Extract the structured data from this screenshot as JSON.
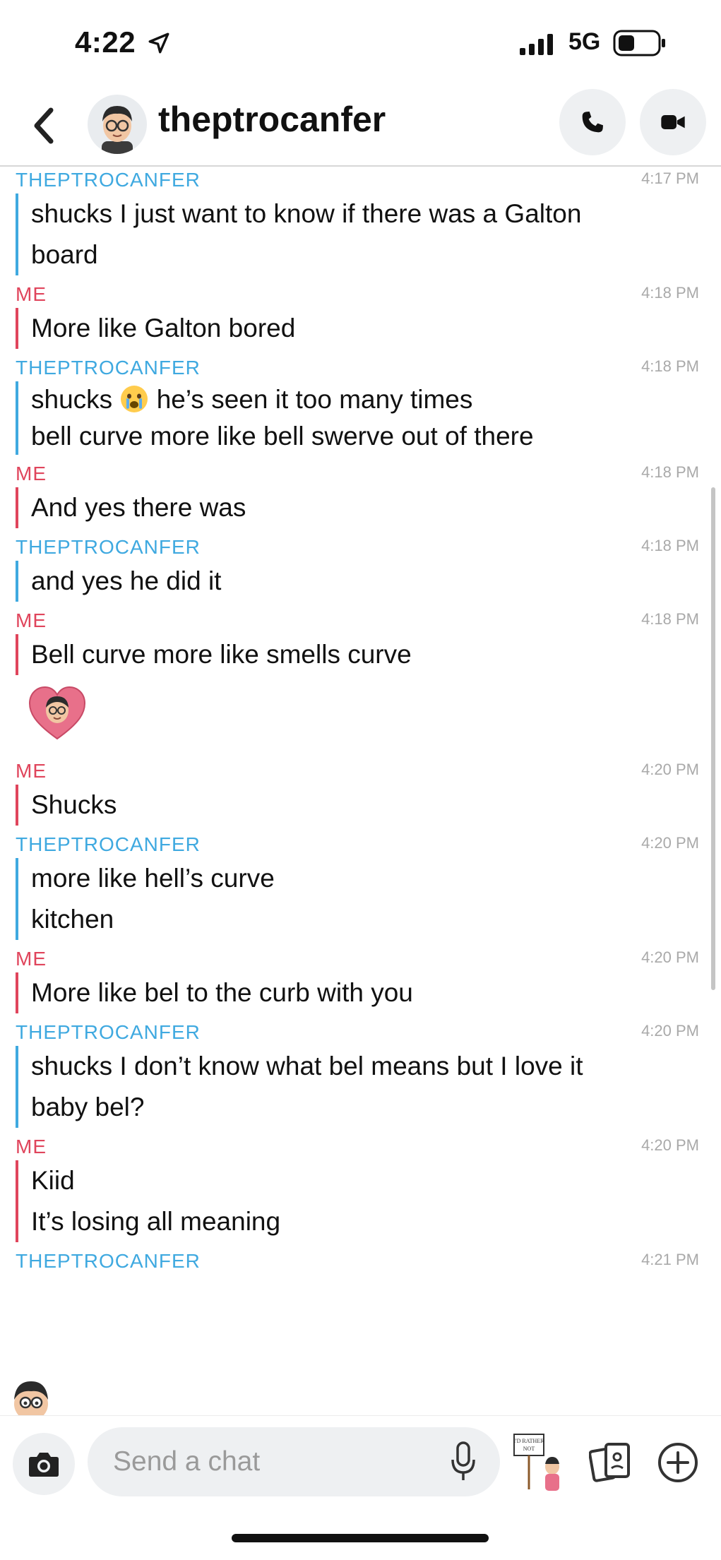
{
  "status": {
    "time": "4:22",
    "network": "5G"
  },
  "header": {
    "title": "theptrocanfer"
  },
  "messages": [
    {
      "sender": "THEPTROCANFER",
      "from": "them",
      "time": "4:17 PM",
      "lines": [
        "shucks I just want to know if there was a Galton",
        "board"
      ]
    },
    {
      "sender": "ME",
      "from": "me",
      "time": "4:18 PM",
      "lines": [
        "More like Galton bored"
      ]
    },
    {
      "sender": "THEPTROCANFER",
      "from": "them",
      "time": "4:18 PM",
      "lines": [
        "shucks",
        "he’s seen it too many times",
        "bell curve more like bell swerve out of there"
      ]
    },
    {
      "sender": "ME",
      "from": "me",
      "time": "4:18 PM",
      "lines": [
        "And yes there was"
      ]
    },
    {
      "sender": "THEPTROCANFER",
      "from": "them",
      "time": "4:18 PM",
      "lines": [
        "and yes he did it"
      ]
    },
    {
      "sender": "ME",
      "from": "me",
      "time": "4:18 PM",
      "lines": [
        "Bell curve more like smells curve"
      ]
    },
    {
      "sender": "ME",
      "from": "me",
      "time": "4:20 PM",
      "lines": [
        "Shucks"
      ]
    },
    {
      "sender": "THEPTROCANFER",
      "from": "them",
      "time": "4:20 PM",
      "lines": [
        "more like hell’s curve",
        "kitchen"
      ]
    },
    {
      "sender": "ME",
      "from": "me",
      "time": "4:20 PM",
      "lines": [
        "More like bel to the curb with you"
      ]
    },
    {
      "sender": "THEPTROCANFER",
      "from": "them",
      "time": "4:20 PM",
      "lines": [
        "shucks I don’t know what bel means but I love it",
        "baby bel?"
      ]
    },
    {
      "sender": "ME",
      "from": "me",
      "time": "4:20 PM",
      "lines": [
        "Kiid",
        "It’s losing all meaning"
      ]
    },
    {
      "sender": "THEPTROCANFER",
      "from": "them",
      "time": "4:21 PM",
      "lines": []
    }
  ],
  "icons": {
    "location": "location-arrow-icon",
    "crying_emoji": "crying-face-emoji",
    "heart_sticker": "heart-bitmoji-sticker",
    "sticker_sign_text": "I'D RATHER NOT"
  },
  "footer": {
    "placeholder": "Send a chat"
  },
  "colors": {
    "them": "#3fa9e0",
    "me": "#e0455c",
    "button_bg": "#eef0f2"
  }
}
